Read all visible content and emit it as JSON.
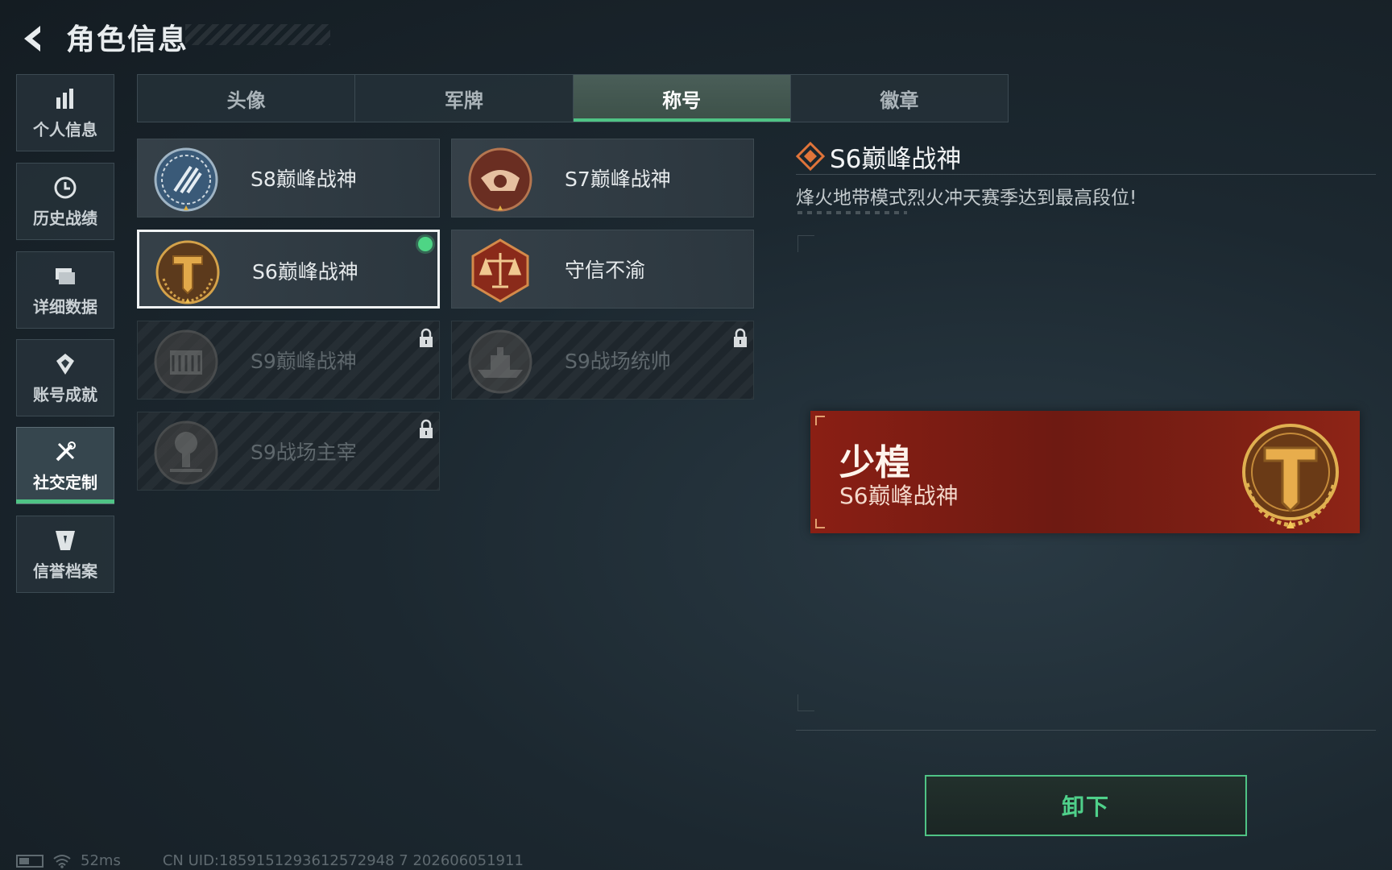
{
  "header": {
    "title": "角色信息"
  },
  "sidebar": {
    "items": [
      {
        "label": "个人信息",
        "icon": "bar-chart-icon"
      },
      {
        "label": "历史战绩",
        "icon": "history-clock-icon"
      },
      {
        "label": "详细数据",
        "icon": "folder-icon"
      },
      {
        "label": "账号成就",
        "icon": "achievement-icon"
      },
      {
        "label": "社交定制",
        "icon": "tools-icon",
        "active": true
      },
      {
        "label": "信誉档案",
        "icon": "credit-shield-icon"
      }
    ]
  },
  "tabs": [
    {
      "label": "头像"
    },
    {
      "label": "军牌"
    },
    {
      "label": "称号",
      "active": true
    },
    {
      "label": "徽章"
    }
  ],
  "titles": [
    {
      "name": "S8巅峰战神",
      "locked": false
    },
    {
      "name": "S7巅峰战神",
      "locked": false
    },
    {
      "name": "S6巅峰战神",
      "locked": false,
      "selected": true,
      "equipped": true
    },
    {
      "name": "守信不渝",
      "locked": false
    },
    {
      "name": "S9巅峰战神",
      "locked": true
    },
    {
      "name": "S9战场统帅",
      "locked": true
    },
    {
      "name": "S9战场主宰",
      "locked": true
    }
  ],
  "detail": {
    "title": "S6巅峰战神",
    "description": "烽火地带模式烈火冲天赛季达到最高段位!"
  },
  "banner": {
    "player_name": "少楻",
    "title": "S6巅峰战神"
  },
  "actions": {
    "unequip_label": "卸下"
  },
  "status": {
    "ping": "52ms",
    "uid": "CN UID:1859151293612572948 7 202606051911"
  },
  "colors": {
    "accent": "#4fc385",
    "banner": "#7d1f14"
  }
}
